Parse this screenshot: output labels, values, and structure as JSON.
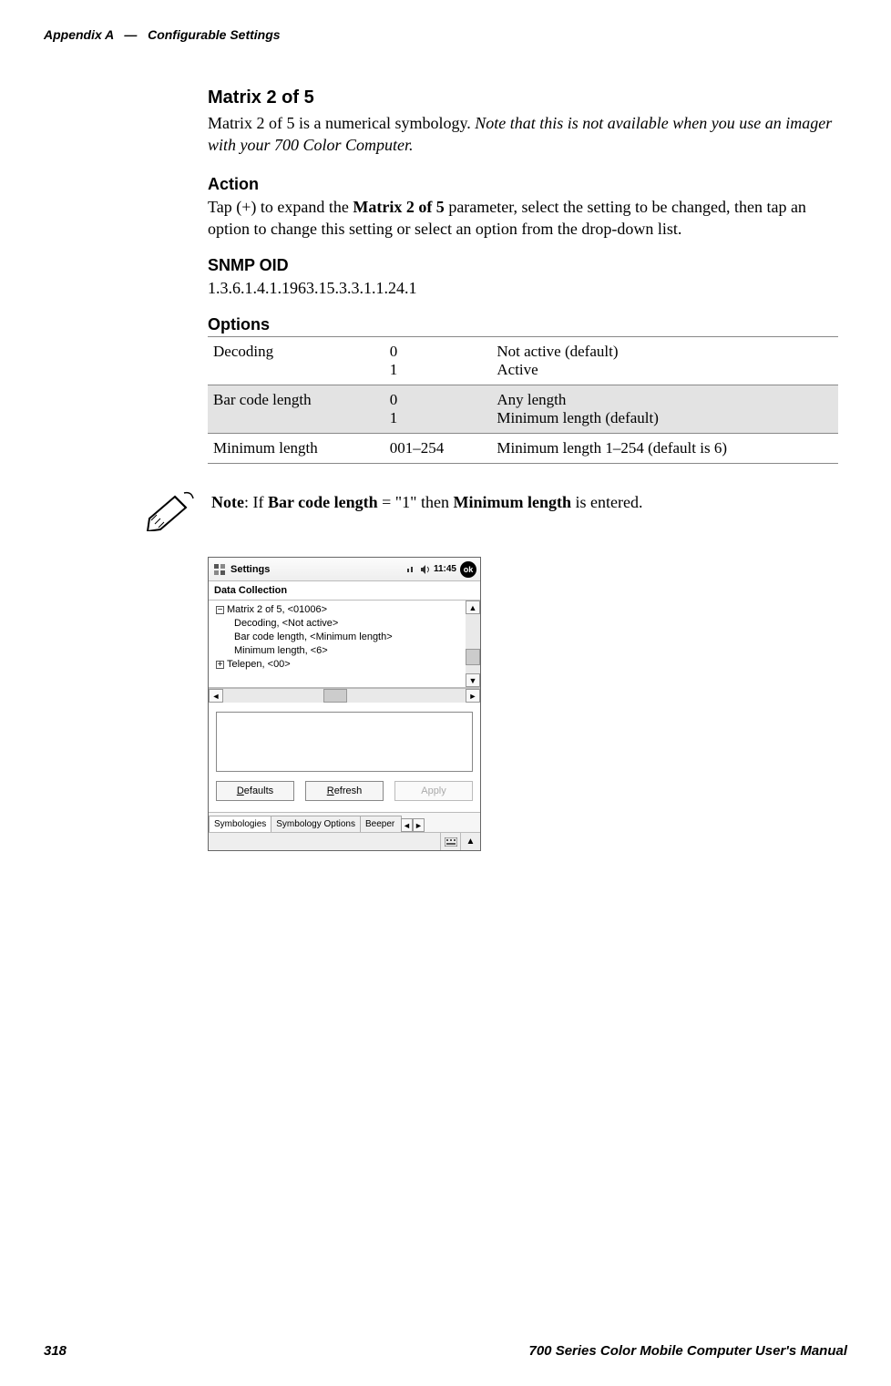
{
  "header": {
    "appendix": "Appendix A",
    "sep": "—",
    "title": "Configurable Settings"
  },
  "section": {
    "title": "Matrix 2 of 5",
    "intro_plain": "Matrix 2 of 5 is a numerical symbology. ",
    "intro_italic": "Note that this is not available when you use an imager with your 700 Color Computer."
  },
  "action": {
    "heading": "Action",
    "pre": "Tap (+) to expand the ",
    "bold": "Matrix 2 of 5",
    "post": " parameter, select the setting to be changed, then tap an option to change this setting or select an option from the drop-down list."
  },
  "snmp": {
    "heading": "SNMP OID",
    "value": "1.3.6.1.4.1.1963.15.3.3.1.1.24.1"
  },
  "options": {
    "heading": "Options",
    "rows": [
      {
        "name": "Decoding",
        "codes": "0\n1",
        "desc": "Not active (default)\nActive",
        "shaded": false
      },
      {
        "name": "Bar code length",
        "codes": "0\n1",
        "desc": "Any length\nMinimum length (default)",
        "shaded": true
      },
      {
        "name": "Minimum length",
        "codes": "001–254",
        "desc": "Minimum length 1–254 (default is 6)",
        "shaded": false
      }
    ]
  },
  "note": {
    "pre": "Note",
    "t1": ": If ",
    "b1": "Bar code length",
    "t2": " = \"1\" then ",
    "b2": "Minimum length",
    "t3": " is entered."
  },
  "pda": {
    "title": "Settings",
    "time": "11:45",
    "ok": "ok",
    "panel_title": "Data Collection",
    "tree": {
      "root": "Matrix 2 of 5, <01006>",
      "items": [
        "Decoding, <Not active>",
        "Bar code length, <Minimum length>",
        "Minimum length, <6>"
      ],
      "sibling": "Telepen, <00>"
    },
    "buttons": {
      "defaults": "Defaults",
      "defaults_ul": "D",
      "refresh": "Refresh",
      "refresh_ul": "R",
      "apply": "Apply",
      "apply_ul": "A"
    },
    "tabs": {
      "t1": "Symbologies",
      "t2": "Symbology Options",
      "t3": "Beeper"
    }
  },
  "footer": {
    "page": "318",
    "manual": "700 Series Color Mobile Computer User's Manual"
  }
}
